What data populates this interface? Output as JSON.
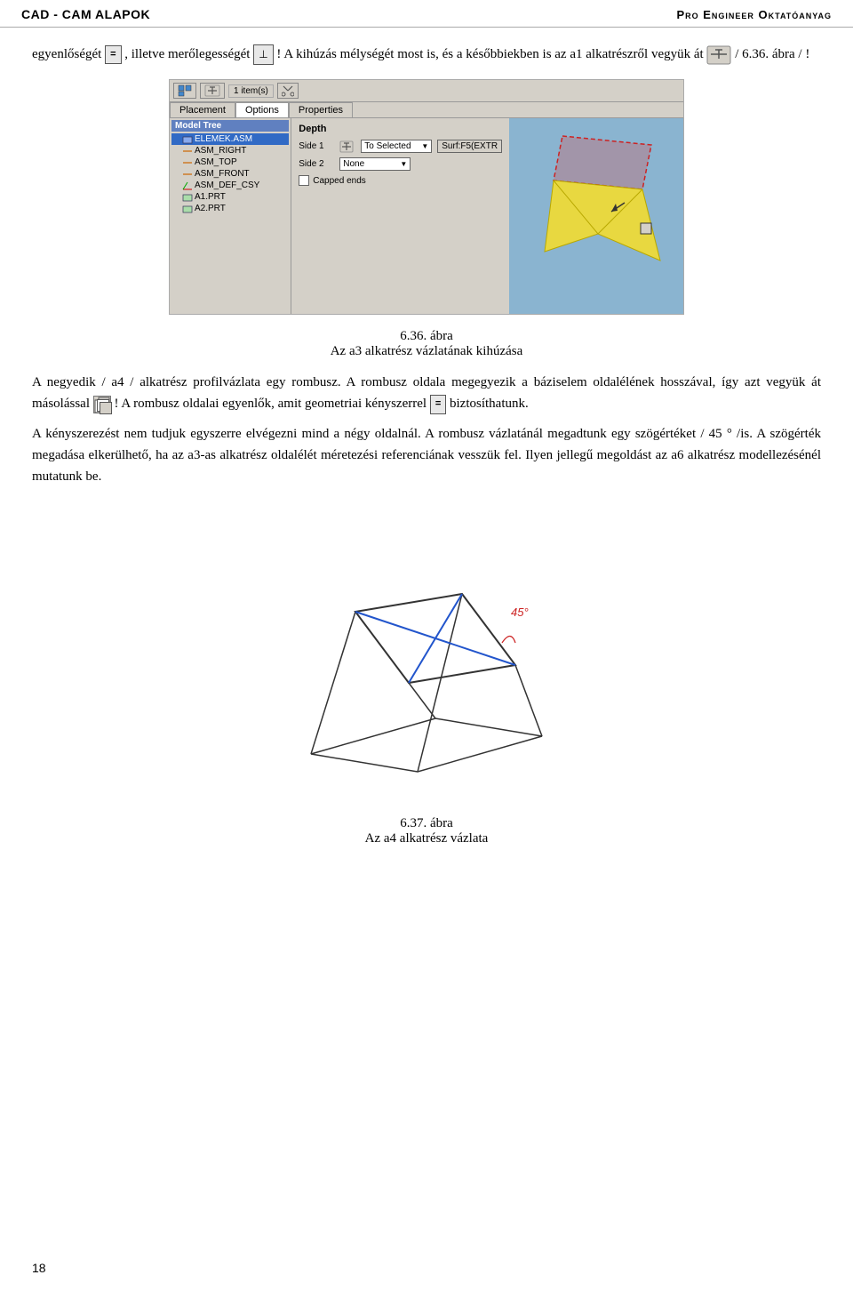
{
  "header": {
    "left": "CAD - CAM ALAPOK",
    "right": "Pro Engineer Oktatóanyag"
  },
  "page_number": "18",
  "intro_line": "egyenlőségét",
  "intro_eq_symbol": "=",
  "intro_mid": ", illetve merőlegességét",
  "intro_perp_symbol": "⊥",
  "intro_rest": "! A kihúzás mélységét most is, és a későbbiekben is az a1 alkatrészről vegyük át",
  "intro_ref_num": "/ 6.36. ábra / !",
  "figure_label_36": "6.36.",
  "figure_caption_36": "ábra",
  "figure_subtitle_36": "Az a3 alkatrész vázlatának kihúzása",
  "para1": "A negyedik / a4 / alkatrész profilvázlata egy rombusz. A rombusz oldala megegyezik a báziselem oldalélének hosszával, így azt vegyük át másolással",
  "para1_rest": "! A rombusz oldalai egyenlők, amit geometriai kényszerrel",
  "para1_eq": "=",
  "para1_bizt": "biztosíthatunk.",
  "para2": "A kényszerezést nem tudjuk egyszerre elvégezni mind a négy oldalnál. A rombusz vázlatánál megadtunk egy szögértéket / 45 ° /is. A szögérték megadása elkerülhető, ha az a3-as alkatrész oldalélét méretezési referenciának vesszük fel. Ilyen jellegű megoldást az a6 alkatrész modellezésénél mutatunk be.",
  "figure_label_37": "6.37.",
  "figure_caption_37": "ábra",
  "figure_subtitle_37": "Az a4 alkatrész vázlata",
  "proe_ui": {
    "toolbar": {
      "item_count": "1 item(s)",
      "tabs": [
        "Placement",
        "Options",
        "Properties"
      ]
    },
    "model_tree": {
      "title": "Model Tree",
      "items": [
        {
          "label": "ELEMEK.ASM",
          "type": "asm",
          "selected": true
        },
        {
          "label": "ASM_RIGHT",
          "type": "datum"
        },
        {
          "label": "ASM_TOP",
          "type": "datum"
        },
        {
          "label": "ASM_FRONT",
          "type": "datum"
        },
        {
          "label": "ASM_DEF_CSY",
          "type": "csys"
        },
        {
          "label": "A1.PRT",
          "type": "prt"
        },
        {
          "label": "A2.PRT",
          "type": "prt"
        }
      ]
    },
    "depth": {
      "title": "Depth",
      "side1_label": "Side 1",
      "side1_option": "To Selected",
      "side1_surf": "Surf:F5(EXTR",
      "side2_label": "Side 2",
      "side2_option": "None",
      "capped_label": "Capped ends"
    }
  }
}
